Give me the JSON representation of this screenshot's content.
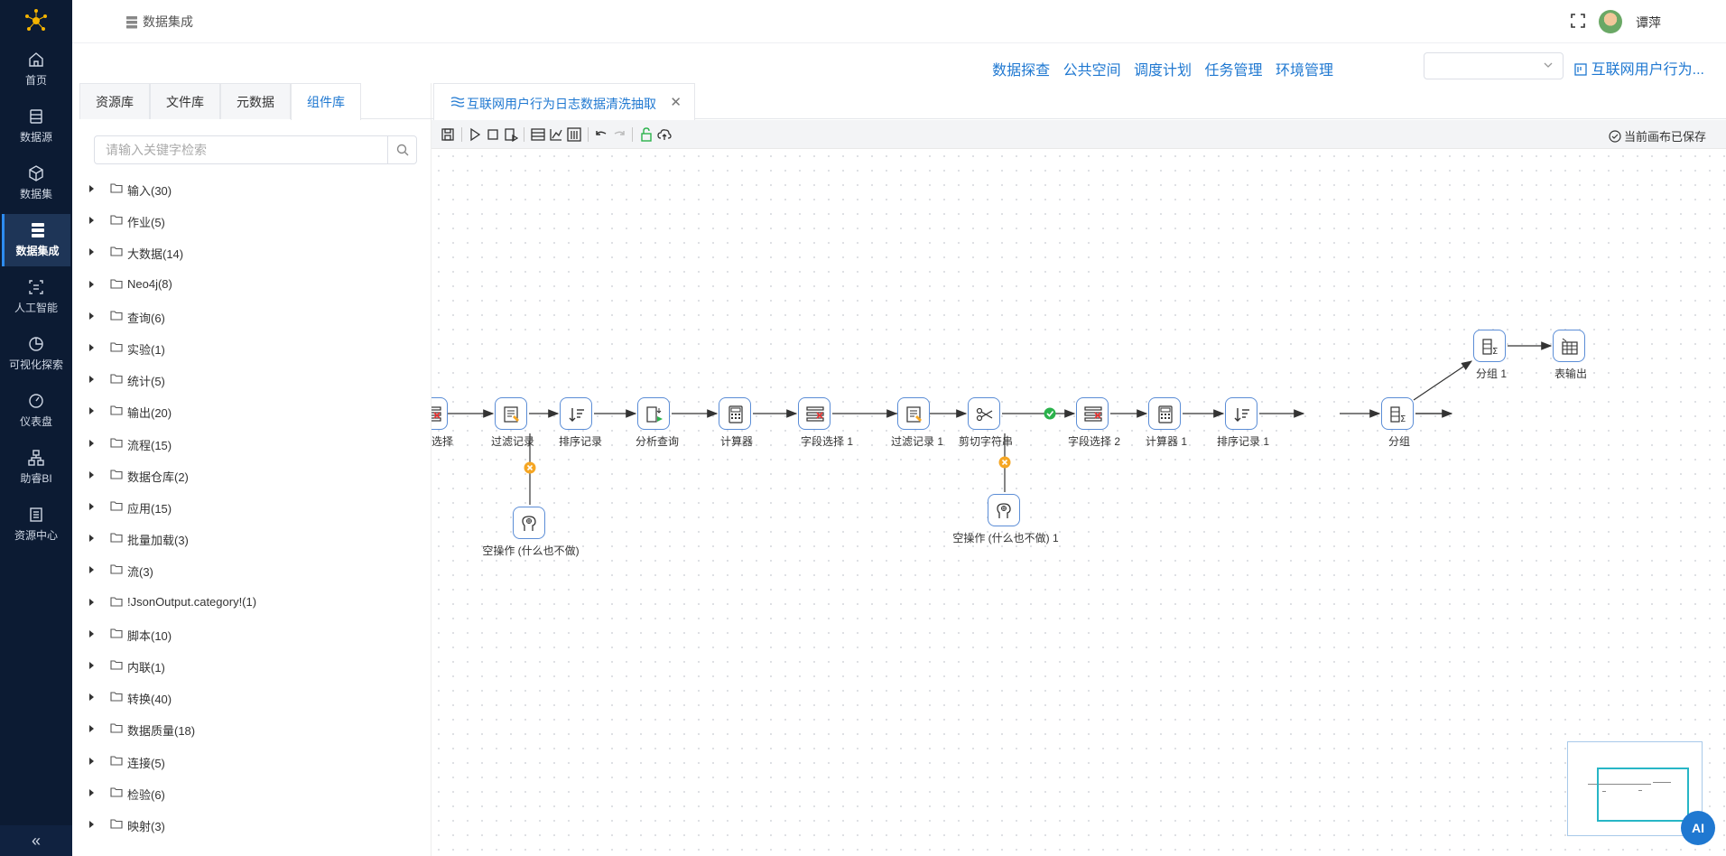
{
  "nav": {
    "items": [
      {
        "label": "首页",
        "icon": "home-icon"
      },
      {
        "label": "数据源",
        "icon": "database-icon"
      },
      {
        "label": "数据集",
        "icon": "cube-icon"
      },
      {
        "label": "数据集成",
        "icon": "server-icon"
      },
      {
        "label": "人工智能",
        "icon": "ai-icon"
      },
      {
        "label": "可视化探索",
        "icon": "pie-icon"
      },
      {
        "label": "仪表盘",
        "icon": "gauge-icon"
      },
      {
        "label": "助睿BI",
        "icon": "org-icon"
      },
      {
        "label": "资源中心",
        "icon": "doc-icon"
      }
    ],
    "active": "数据集成",
    "collapse_glyph": "«"
  },
  "header": {
    "breadcrumb": "数据集成",
    "username": "谭萍"
  },
  "links": [
    "数据探查",
    "公共空间",
    "调度计划",
    "任务管理",
    "环境管理"
  ],
  "project_select": {
    "value": ""
  },
  "project_link": "互联网用户行为...",
  "left_panel": {
    "tabs": [
      "资源库",
      "文件库",
      "元数据",
      "组件库"
    ],
    "active_tab": "组件库",
    "search_placeholder": "请输入关键字检索",
    "tree": [
      "输入(30)",
      "作业(5)",
      "大数据(14)",
      "Neo4j(8)",
      "查询(6)",
      "实验(1)",
      "统计(5)",
      "输出(20)",
      "流程(15)",
      "数据仓库(2)",
      "应用(15)",
      "批量加载(3)",
      "流(3)",
      "!JsonOutput.category!(1)",
      "脚本(10)",
      "内联(1)",
      "转换(40)",
      "数据质量(18)",
      "连接(5)",
      "检验(6)",
      "映射(3)"
    ]
  },
  "editor": {
    "tab_label": "互联网用户行为日志数据清洗抽取",
    "close_glyph": "✕",
    "saved_status": "当前画布已保存"
  },
  "flow": {
    "nodes": [
      {
        "id": "n0",
        "label": "选择",
        "icon": "field-select-icon"
      },
      {
        "id": "n1",
        "label": "过滤记录",
        "icon": "filter-icon"
      },
      {
        "id": "n2",
        "label": "排序记录",
        "icon": "sort-icon"
      },
      {
        "id": "n3",
        "label": "分析查询",
        "icon": "analytic-icon"
      },
      {
        "id": "n4",
        "label": "计算器",
        "icon": "calculator-icon"
      },
      {
        "id": "n5",
        "label": "字段选择 1",
        "icon": "field-select-icon"
      },
      {
        "id": "n6",
        "label": "过滤记录 1",
        "icon": "filter-icon"
      },
      {
        "id": "n7",
        "label": "剪切字符串",
        "icon": "scissors-icon"
      },
      {
        "id": "n8",
        "label": "字段选择 2",
        "icon": "field-select-icon"
      },
      {
        "id": "n9",
        "label": "计算器 1",
        "icon": "calculator-icon"
      },
      {
        "id": "n10",
        "label": "排序记录 1",
        "icon": "sort-icon"
      },
      {
        "id": "n11",
        "label": "分组",
        "icon": "group-icon"
      },
      {
        "id": "n12",
        "label": "分组 1",
        "icon": "group-icon"
      },
      {
        "id": "n13",
        "label": "表输出",
        "icon": "table-output-icon"
      },
      {
        "id": "n14",
        "label": "空操作 (什么也不做)",
        "icon": "dummy-icon"
      },
      {
        "id": "n15",
        "label": "空操作 (什么也不做) 1",
        "icon": "dummy-icon"
      }
    ]
  },
  "ai_button": "AI",
  "colors": {
    "nav_bg": "#0c1b33",
    "accent": "#1f78d1",
    "ok": "#2bb24c",
    "fail": "#f5a623"
  }
}
